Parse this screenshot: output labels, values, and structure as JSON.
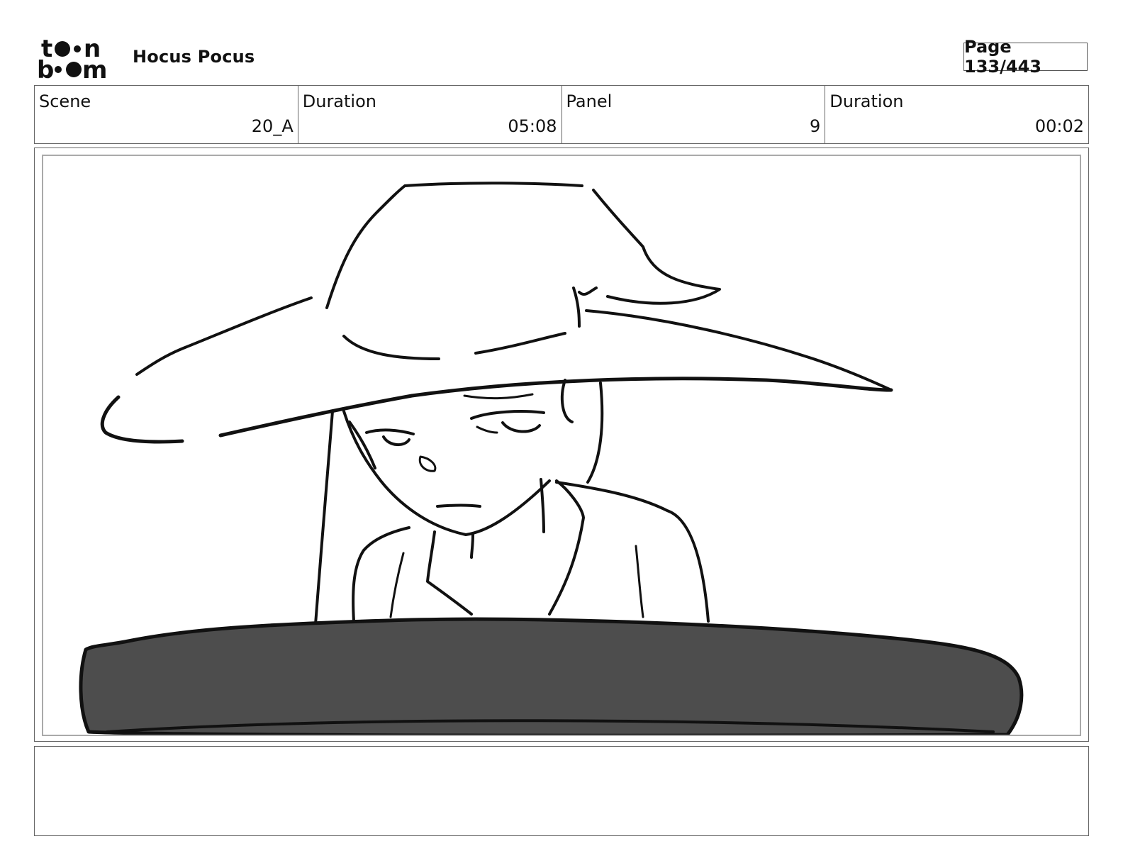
{
  "header": {
    "logo_text": "toon boom",
    "project_title": "Hocus Pocus",
    "page_label": "Page 133/443"
  },
  "info": [
    {
      "label": "Scene",
      "value": "20_A"
    },
    {
      "label": "Duration",
      "value": "05:08"
    },
    {
      "label": "Panel",
      "value": "9"
    },
    {
      "label": "Duration",
      "value": "00:02"
    }
  ],
  "panel": {
    "image_alt": "Storyboard sketch: girl in a large witch hat looking down behind a dark cushion",
    "cushion_color": "#4d4d4d"
  },
  "notes": {
    "text": ""
  }
}
